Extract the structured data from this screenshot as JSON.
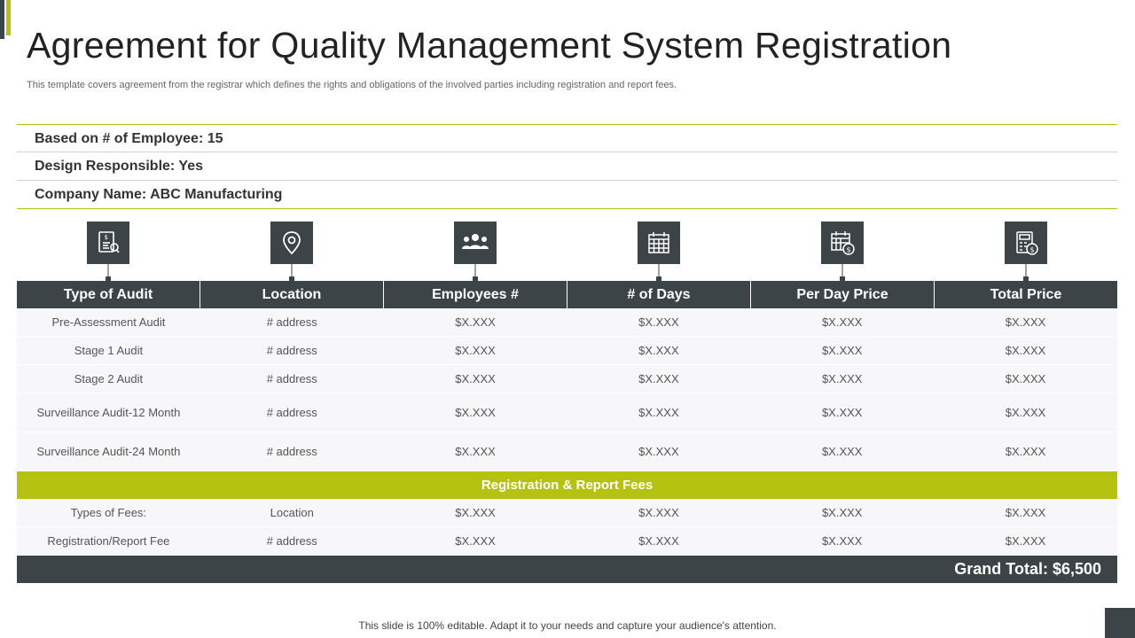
{
  "header": {
    "title": "Agreement for Quality Management System Registration",
    "subtitle": "This template covers agreement from the registrar which defines the rights and obligations of the involved  parties including registration and report fees."
  },
  "info": [
    "Based on # of Employee: 15",
    "Design Responsible: Yes",
    "Company Name: ABC Manufacturing"
  ],
  "icons": [
    "audit-document-icon",
    "location-pin-icon",
    "employees-group-icon",
    "calendar-icon",
    "calendar-price-icon",
    "calculator-price-icon"
  ],
  "table": {
    "columns": [
      "Type of Audit",
      "Location",
      "Employees #",
      "# of Days",
      "Per Day Price",
      "Total Price"
    ],
    "rows": [
      [
        "Pre-Assessment Audit",
        "# address",
        "$X.XXX",
        "$X.XXX",
        "$X.XXX",
        "$X.XXX"
      ],
      [
        "Stage 1 Audit",
        "# address",
        "$X.XXX",
        "$X.XXX",
        "$X.XXX",
        "$X.XXX"
      ],
      [
        "Stage 2 Audit",
        "# address",
        "$X.XXX",
        "$X.XXX",
        "$X.XXX",
        "$X.XXX"
      ],
      [
        "Surveillance  Audit-12 Month",
        "# address",
        "$X.XXX",
        "$X.XXX",
        "$X.XXX",
        "$X.XXX"
      ],
      [
        "Surveillance  Audit-24 Month",
        "# address",
        "$X.XXX",
        "$X.XXX",
        "$X.XXX",
        "$X.XXX"
      ]
    ],
    "section_label": "Registration & Report Fees",
    "fee_rows": [
      [
        "Types  of Fees:",
        "Location",
        "$X.XXX",
        "$X.XXX",
        "$X.XXX",
        "$X.XXX"
      ],
      [
        "Registration/Report  Fee",
        "# address",
        "$X.XXX",
        "$X.XXX",
        "$X.XXX",
        "$X.XXX"
      ]
    ],
    "grand_total": "Grand Total: $6,500"
  },
  "footer": "This slide is 100% editable. Adapt it to your needs and capture your audience's attention.",
  "colors": {
    "dark": "#3d4447",
    "accent": "#b5c20f"
  }
}
